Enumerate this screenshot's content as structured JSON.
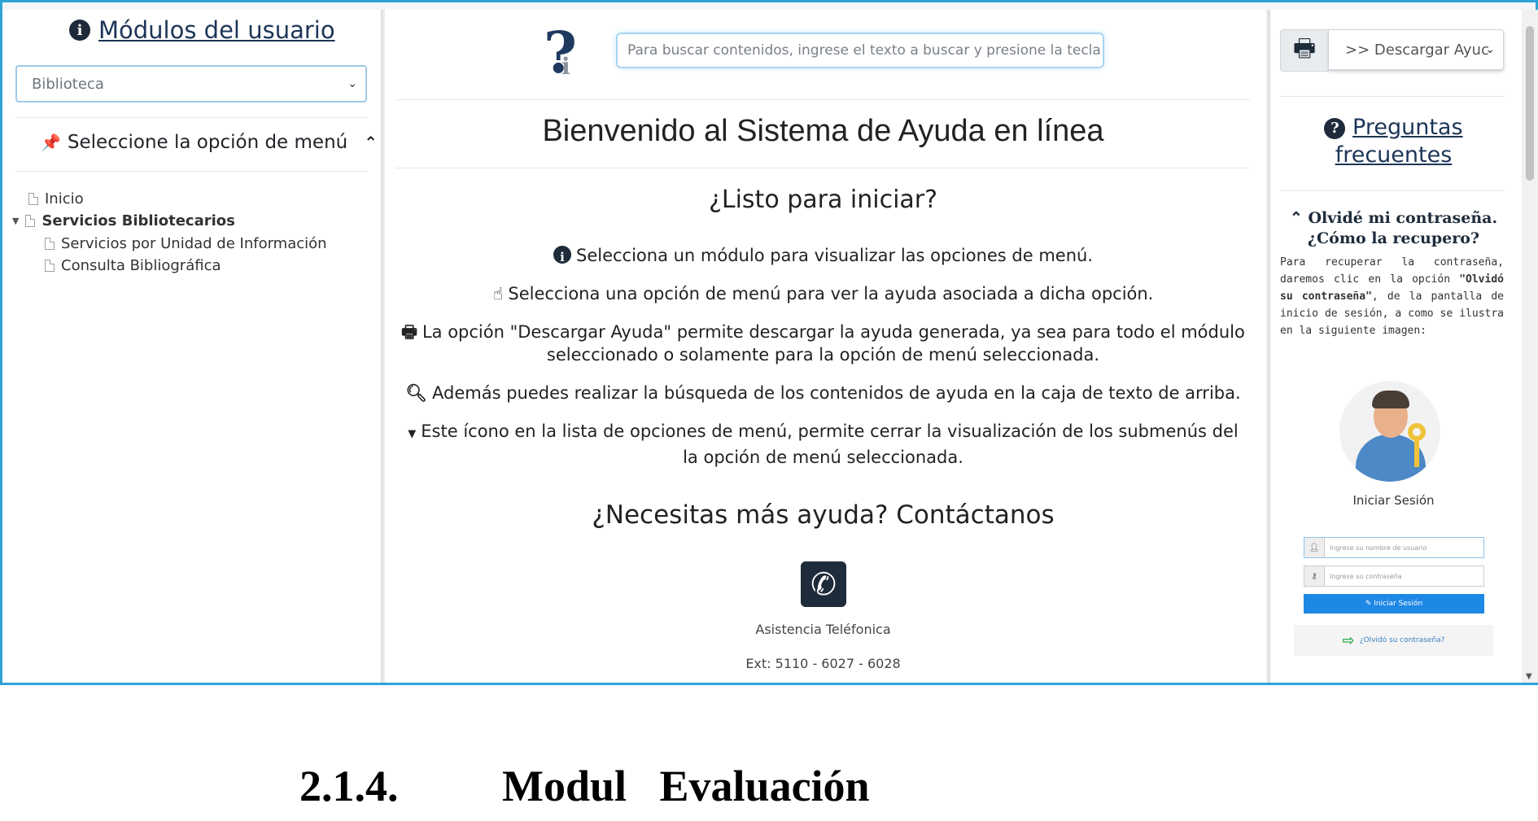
{
  "left": {
    "title": "Módulos del usuario",
    "module_select": "Biblioteca",
    "menu_heading": "Seleccione la opción de menú",
    "tree": {
      "inicio": "Inicio",
      "servicios": "Servicios Bibliotecarios",
      "unidad": "Servicios por Unidad de Información",
      "consulta": "Consulta Bibliográfica"
    }
  },
  "center": {
    "search_placeholder": "Para buscar contenidos, ingrese el texto a buscar y presione la tecla E",
    "welcome": "Bienvenido al Sistema de Ayuda en línea",
    "ready": "¿Listo para iniciar?",
    "line1": "Selecciona un módulo para visualizar las opciones de menú.",
    "line2": "Selecciona una opción de menú para ver la ayuda asociada a dicha opción.",
    "line3a": "La opción \"Descargar Ayuda\" permite descargar la ayuda generada, ya sea para todo el módulo",
    "line3b": "seleccionado o solamente para la opción de menú seleccionada.",
    "line4": "Además puedes realizar la búsqueda de los contenidos de ayuda en la caja de texto de arriba.",
    "line5a": "Este ícono en la lista de opciones de menú, permite cerrar la visualización de los submenús del",
    "line5b": "la opción de menú seleccionada.",
    "need_help": "¿Necesitas más ayuda? Contáctanos",
    "phone_label": "Asistencia Teléfonica",
    "extensions": "Ext: 5110 - 6027 - 6028"
  },
  "right": {
    "download_select": ">> Descargar Ayuc",
    "faq_line1": "Preguntas",
    "faq_line2": "frecuentes",
    "question_line1": "Olvidé mi contraseña.",
    "question_line2": "¿Cómo la recupero?",
    "answer_pre": "Para recuperar la contraseña, daremos clic en la opción ",
    "answer_bold": "\"Olvidó su contraseña\"",
    "answer_post": ", de la pantalla de inicio de sesión, a como se ilustra en la siguiente imagen:",
    "login_title": "Iniciar Sesión",
    "user_placeholder": "Ingrese su nombre de usuario",
    "pass_placeholder": "Ingrese su contraseña",
    "login_button": "Iniciar Sesión",
    "forgot_link": "¿Olvidó su contraseña?"
  },
  "caption": {
    "number": "2.1.4.",
    "title": "Modul   Evaluación"
  },
  "colors": {
    "frame_border": "#2ea3d6",
    "dark_icon": "#1d2b3a",
    "link": "#1d3557",
    "login_button": "#1e88e5"
  }
}
